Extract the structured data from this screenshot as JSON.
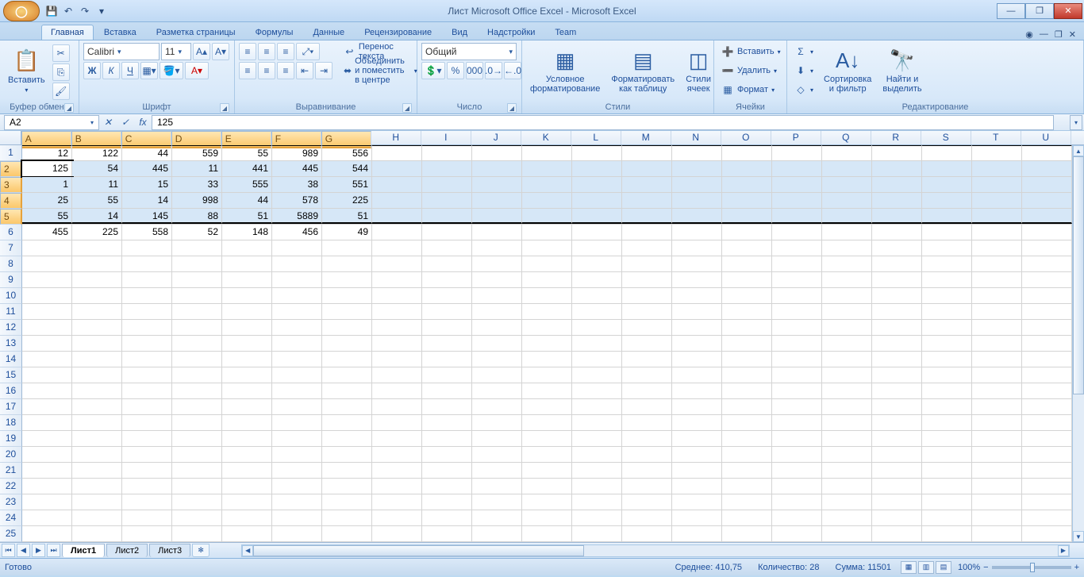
{
  "title": "Лист Microsoft Office Excel - Microsoft Excel",
  "tabs": [
    "Главная",
    "Вставка",
    "Разметка страницы",
    "Формулы",
    "Данные",
    "Рецензирование",
    "Вид",
    "Надстройки",
    "Team"
  ],
  "active_tab": 0,
  "ribbon": {
    "clipboard": {
      "paste": "Вставить",
      "label": "Буфер обмена"
    },
    "font": {
      "name": "Calibri",
      "size": "11",
      "label": "Шрифт",
      "bold": "Ж",
      "italic": "К",
      "underline": "Ч"
    },
    "align": {
      "wrap": "Перенос текста",
      "merge": "Объединить и поместить в центре",
      "label": "Выравнивание"
    },
    "number": {
      "format": "Общий",
      "label": "Число"
    },
    "styles": {
      "cond": "Условное\nформатирование",
      "table": "Форматировать\nкак таблицу",
      "cell": "Стили\nячеек",
      "label": "Стили"
    },
    "cells": {
      "insert": "Вставить",
      "delete": "Удалить",
      "format": "Формат",
      "label": "Ячейки"
    },
    "edit": {
      "sort": "Сортировка\nи фильтр",
      "find": "Найти и\nвыделить",
      "label": "Редактирование"
    }
  },
  "namebox": "A2",
  "formula": "125",
  "columns": [
    "A",
    "B",
    "C",
    "D",
    "E",
    "F",
    "G",
    "H",
    "I",
    "J",
    "K",
    "L",
    "M",
    "N",
    "O",
    "P",
    "Q",
    "R",
    "S",
    "T",
    "U"
  ],
  "selected_cols": [
    "A",
    "B",
    "C",
    "D",
    "E",
    "F",
    "G"
  ],
  "rows_total": 25,
  "selected_rows": [
    2,
    3,
    4,
    5
  ],
  "active_cell": {
    "row": 2,
    "col": 0
  },
  "data": [
    [
      12,
      122,
      44,
      559,
      55,
      989,
      556
    ],
    [
      125,
      54,
      445,
      11,
      441,
      445,
      544
    ],
    [
      1,
      11,
      15,
      33,
      555,
      38,
      551
    ],
    [
      25,
      55,
      14,
      998,
      44,
      578,
      225
    ],
    [
      55,
      14,
      145,
      88,
      51,
      5889,
      51
    ],
    [
      455,
      225,
      558,
      52,
      148,
      456,
      49
    ]
  ],
  "border_top_row": 1,
  "border_bot_row": 5,
  "sheets": [
    "Лист1",
    "Лист2",
    "Лист3"
  ],
  "active_sheet": 0,
  "status": {
    "ready": "Готово",
    "avg_lbl": "Среднее:",
    "avg": "410,75",
    "cnt_lbl": "Количество:",
    "cnt": "28",
    "sum_lbl": "Сумма:",
    "sum": "11501",
    "zoom": "100%"
  }
}
